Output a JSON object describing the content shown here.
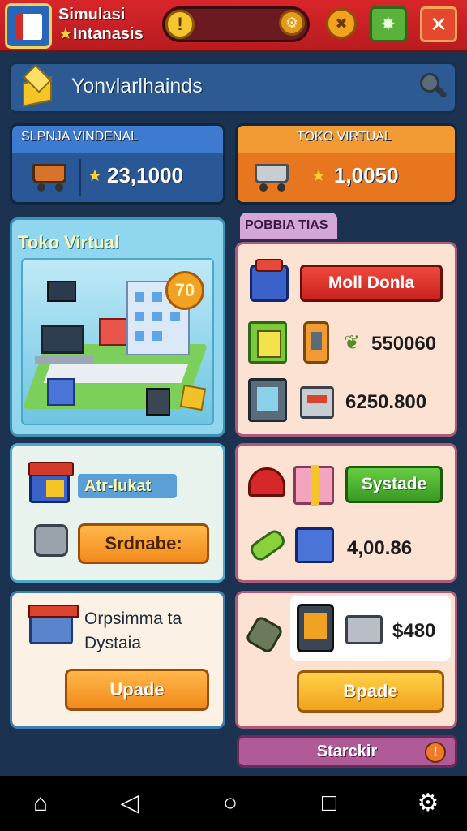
{
  "app": {
    "title_line1": "Simulasi",
    "title_line2": "Intanasis",
    "title_star": "★",
    "alert_icon": "!",
    "close_icon": "✕"
  },
  "banner": {
    "text": "Yonvlarlhainds"
  },
  "stats": {
    "left": {
      "label": "SLPNJA VINDENAL",
      "value": "23,1000"
    },
    "right": {
      "label": "TOKO VIRTUAL",
      "value": "1,0050"
    }
  },
  "left_panel": {
    "title": "Toko Virtual",
    "scene_badge": "70"
  },
  "mint_panel": {
    "chip": "Atr-lukat",
    "button": "Srdnabe:"
  },
  "cream_panel": {
    "desc_line1": "Orpsimma ta",
    "desc_line2": "Dystaia",
    "button": "Upade"
  },
  "right_tab": "POBBIA TIAS",
  "right_panel1": {
    "red_button": "Moll Donla",
    "value1": "550060",
    "value2": "6250.800"
  },
  "right_panel2": {
    "green_button": "Systade",
    "value": "4,00.86"
  },
  "right_panel3": {
    "value": "$480",
    "button": "Bpade"
  },
  "bottom_pill": {
    "label": "Starckir",
    "badge": "!"
  },
  "icons": [
    "book-icon",
    "alert-icon",
    "gear-icon",
    "wrench-icon",
    "puzzle-icon",
    "close-icon",
    "cube-icon",
    "search-icon",
    "cart-icon",
    "star-icon",
    "home-icon",
    "back-icon",
    "circle-icon",
    "square-icon",
    "settings-icon"
  ],
  "colors": {
    "topbar": "#d8262a",
    "background": "#1b3350",
    "accent_orange": "#f29a34",
    "accent_blue": "#3d7ad0"
  }
}
